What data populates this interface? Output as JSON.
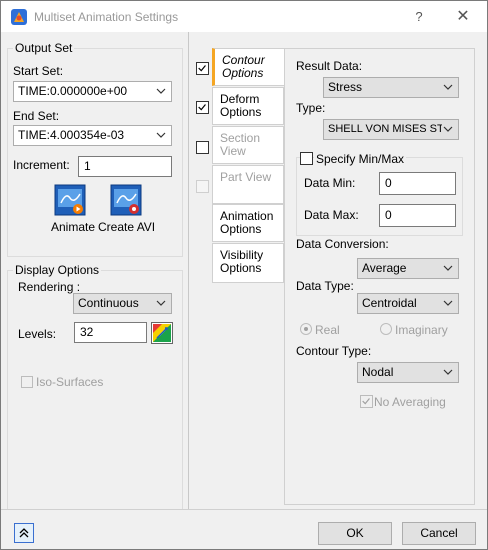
{
  "window": {
    "title": "Multiset Animation Settings",
    "help": "?",
    "close": "✕"
  },
  "output_set": {
    "title": "Output Set",
    "start_label": "Start Set:",
    "start_value": "TIME:0.000000e+00",
    "end_label": "End Set:",
    "end_value": "TIME:4.000354e-03",
    "increment_label": "Increment:",
    "increment_value": "1",
    "animate_label": "Animate",
    "create_avi_label": "Create AVI"
  },
  "display_options": {
    "title": "Display Options",
    "rendering_label": "Rendering :",
    "rendering_value": "Continuous",
    "levels_label": "Levels:",
    "levels_value": "32",
    "iso_surfaces_label": "Iso-Surfaces"
  },
  "tabs": [
    {
      "label": "Contour Options",
      "checked": true
    },
    {
      "label": "Deform Options",
      "checked": true
    },
    {
      "label": "Section View",
      "checked": false
    },
    {
      "label": "Part View",
      "checked": false
    },
    {
      "label": "Animation Options"
    },
    {
      "label": "Visibility Options"
    }
  ],
  "contour": {
    "result_data_label": "Result Data:",
    "result_data_value": "Stress",
    "type_label": "Type:",
    "type_value": "SHELL VON MISES STR",
    "specify_label": "Specify Min/Max",
    "data_min_label": "Data Min:",
    "data_min_value": "0",
    "data_max_label": "Data Max:",
    "data_max_value": "0",
    "conversion_label": "Data Conversion:",
    "conversion_value": "Average",
    "data_type_label": "Data Type:",
    "data_type_value": "Centroidal",
    "real_label": "Real",
    "imaginary_label": "Imaginary",
    "contour_type_label": "Contour Type:",
    "contour_type_value": "Nodal",
    "no_averaging_label": "No Averaging"
  },
  "footer": {
    "expand_icon": "double-chevron-up-icon",
    "ok": "OK",
    "cancel": "Cancel"
  }
}
